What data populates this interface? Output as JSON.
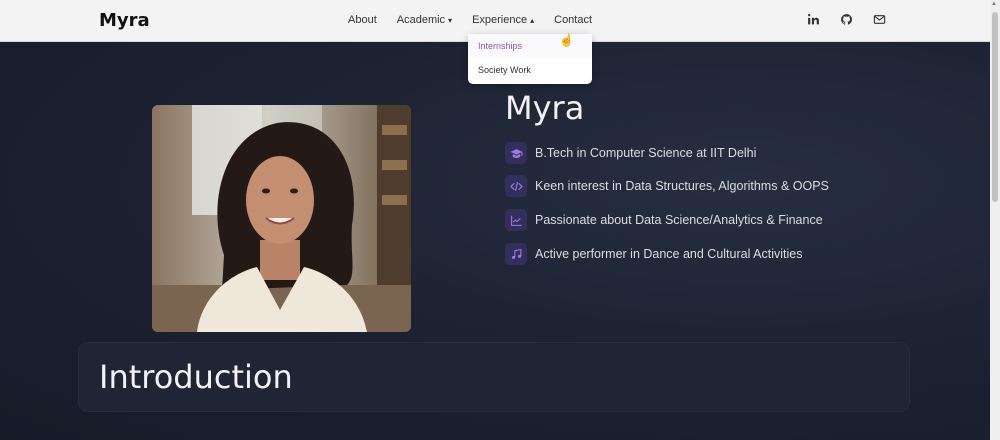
{
  "nav": {
    "brand": "Myra",
    "links": [
      {
        "label": "About"
      },
      {
        "label": "Academic",
        "caret": "▾"
      },
      {
        "label": "Experience",
        "caret": "▴"
      },
      {
        "label": "Contact"
      }
    ],
    "icons": [
      "linkedin-icon",
      "github-icon",
      "mail-icon"
    ]
  },
  "dropdown": {
    "items": [
      "Internships",
      "Society Work"
    ],
    "active_index": 0,
    "active_color": "#8a55c8"
  },
  "hero": {
    "name": "Myra",
    "features": [
      {
        "icon": "graduation-cap-icon",
        "text": "B.Tech in Computer Science at IIT Delhi"
      },
      {
        "icon": "code-icon",
        "text": "Keen interest in Data Structures, Algorithms & OOPS"
      },
      {
        "icon": "chart-line-icon",
        "text": "Passionate about Data Science/Analytics & Finance"
      },
      {
        "icon": "music-note-icon",
        "text": "Active performer in Dance and Cultural Activities"
      }
    ],
    "accent": "#9b7be8"
  },
  "intro": {
    "title": "Introduction"
  },
  "colors": {
    "nav_bg": "#f3f3f3",
    "page_bg": "#1b2130",
    "icon_bg": "#32305a"
  }
}
